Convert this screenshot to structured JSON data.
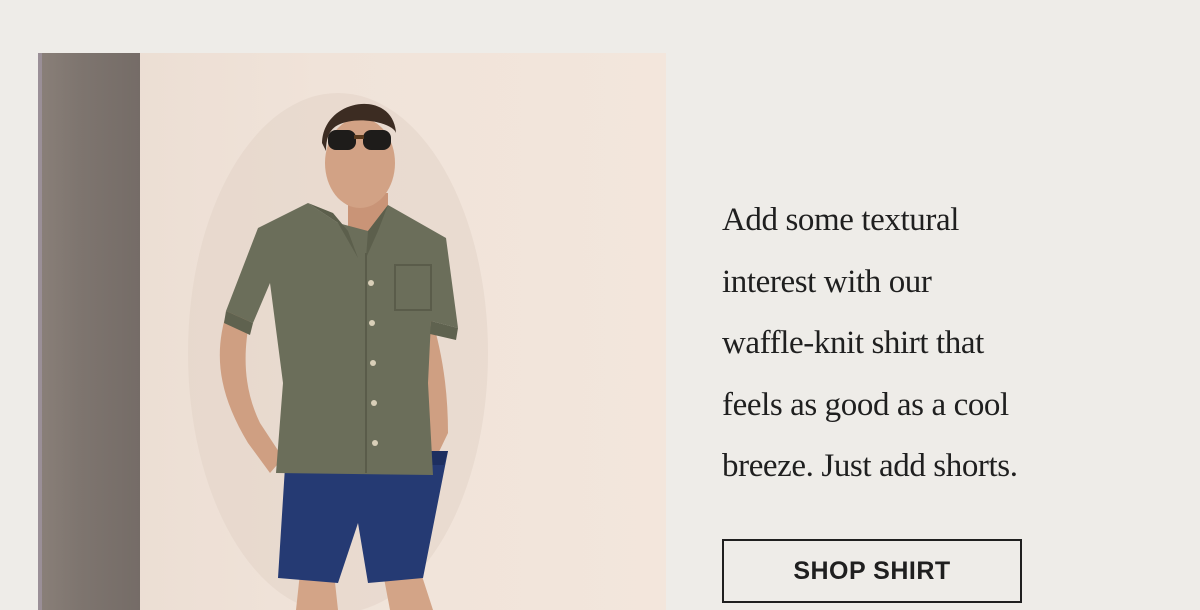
{
  "hero": {
    "image_alt": "Model wearing olive waffle-knit short-sleeve shirt and navy shorts",
    "copy_lines": [
      "Add some textural",
      "interest with our",
      "waffle-knit shirt that",
      "feels as good as a cool",
      "breeze. Just add shorts."
    ],
    "cta_label": "SHOP SHIRT"
  },
  "colors": {
    "background": "#eeece8",
    "text": "#1f1f1f",
    "shirt": "#6b6e5a",
    "shorts": "#253a73"
  }
}
